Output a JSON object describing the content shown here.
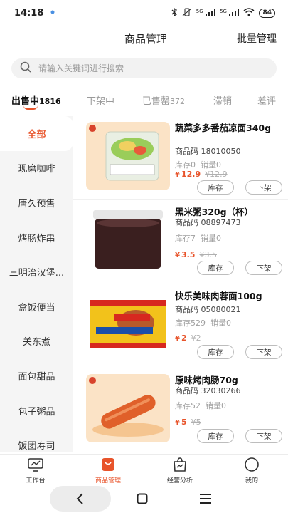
{
  "status": {
    "time": "14:18",
    "battery": "84",
    "signal1": "5G",
    "signal2": "5G"
  },
  "nav": {
    "title": "商品管理",
    "action": "批量管理"
  },
  "search": {
    "placeholder": "请输入关键词进行搜索"
  },
  "tabs": [
    {
      "label": "出售中",
      "count": "1816"
    },
    {
      "label": "下架中",
      "count": ""
    },
    {
      "label": "已售罄",
      "count": "372"
    },
    {
      "label": "滞销",
      "count": ""
    },
    {
      "label": "差评",
      "count": ""
    }
  ],
  "categories": [
    "全部",
    "现磨咖啡",
    "唐久预售",
    "烤肠炸串",
    "三明治汉堡...",
    "盒饭便当",
    "关东煮",
    "面包甜品",
    "包子粥品",
    "饭团寿司"
  ],
  "products": [
    {
      "name": "蔬菜多多番茄凉面340g",
      "code_label": "商品码",
      "code": "18010050",
      "stock": "库存0",
      "sales": "销量0",
      "price": "12.9",
      "orig": "12.9",
      "thumb_text": "蔬菜多多番茄凉面"
    },
    {
      "name": "黑米粥320g（杯）",
      "code_label": "商品码",
      "code": "08897473",
      "stock": "库存7",
      "sales": "销量0",
      "price": "3.5",
      "orig": "3.5",
      "thumb_text": ""
    },
    {
      "name": "快乐美味肉蓉面100g",
      "code_label": "商品码",
      "code": "05080021",
      "stock": "库存529",
      "sales": "销量0",
      "price": "2",
      "orig": "2",
      "thumb_text": "美味肉蓉面"
    },
    {
      "name": "原味烤肉肠70g",
      "code_label": "商品码",
      "code": "32030266",
      "stock": "库存52",
      "sales": "销量0",
      "price": "5",
      "orig": "5",
      "thumb_text": ""
    }
  ],
  "buttons": {
    "stock": "库存",
    "offshelf": "下架"
  },
  "currency": "¥",
  "tabbar": [
    {
      "label": "工作台",
      "icon": "workbench-icon"
    },
    {
      "label": "商品管理",
      "icon": "goods-icon"
    },
    {
      "label": "经营分析",
      "icon": "analysis-icon"
    },
    {
      "label": "我的",
      "icon": "profile-icon"
    }
  ],
  "colors": {
    "accent": "#e8542b",
    "sidebar_bg": "#f5f5f5",
    "search_bg": "#f2f2f2"
  }
}
